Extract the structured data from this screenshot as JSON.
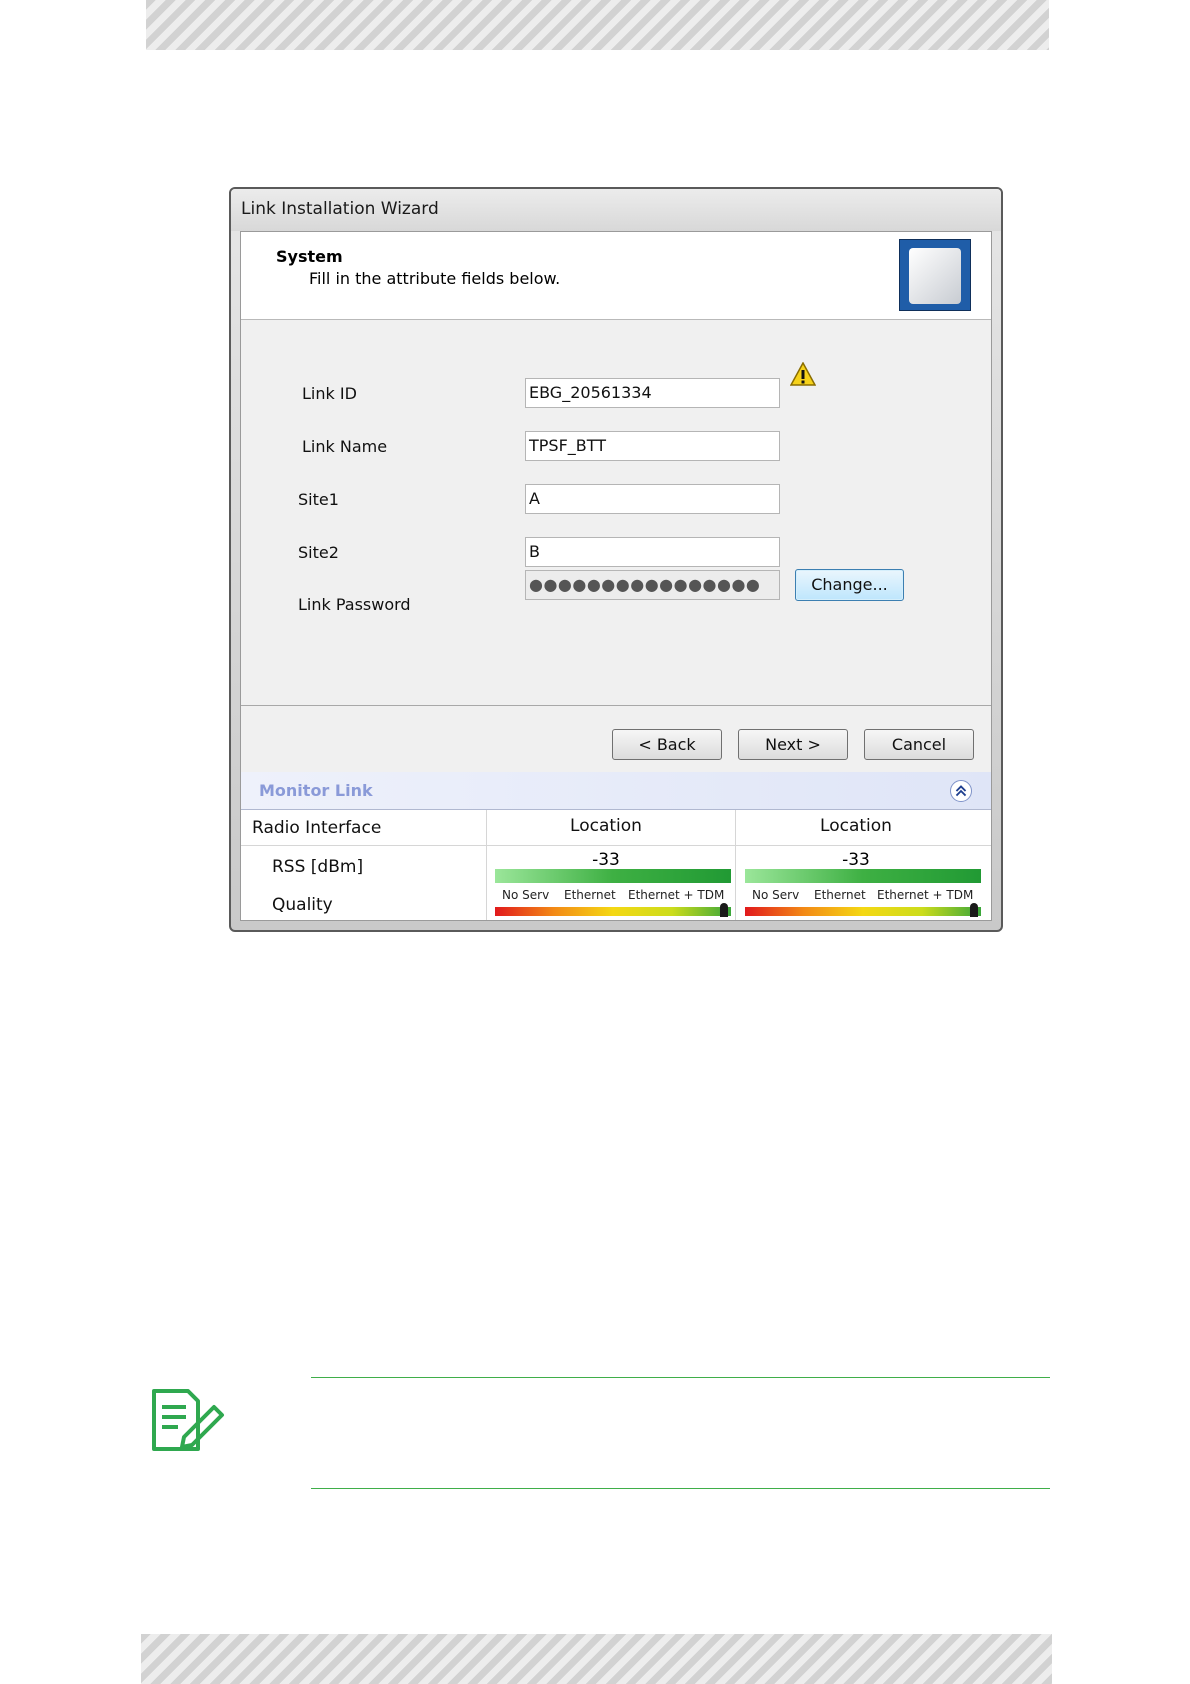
{
  "dialog": {
    "title": "Link Installation Wizard",
    "header": {
      "title": "System",
      "subtitle": "Fill in the attribute fields below."
    },
    "fields": [
      {
        "label": "Link ID",
        "value": "EBG_20561334"
      },
      {
        "label": "Link Name",
        "value": "TPSF_BTT"
      },
      {
        "label": "Site1",
        "value": "A"
      },
      {
        "label": "Site2",
        "value": "B"
      },
      {
        "label": "Link Password",
        "value": "●●●●●●●●●●●●●●●●"
      }
    ],
    "change_button": "Change...",
    "buttons": {
      "back": "< Back",
      "next": "Next >",
      "cancel": "Cancel"
    }
  },
  "monitor": {
    "title": "Monitor Link",
    "columns": [
      "Radio Interface",
      "Location",
      "Location"
    ],
    "rows": {
      "rss_label": "RSS [dBm]",
      "quality_label": "Quality"
    },
    "rss_values": [
      "-33",
      "-33"
    ],
    "quality_scale": [
      "No Serv",
      "Ethernet",
      "Ethernet + TDM"
    ],
    "quality_level": [
      0.98,
      0.98
    ]
  },
  "icons": {
    "warning": "warning-icon",
    "collapse": "double-chevron-up-icon",
    "note": "note-pencil-icon"
  },
  "colors": {
    "note_accent": "#3fae49",
    "monitor_title": "#8a9ad8"
  }
}
